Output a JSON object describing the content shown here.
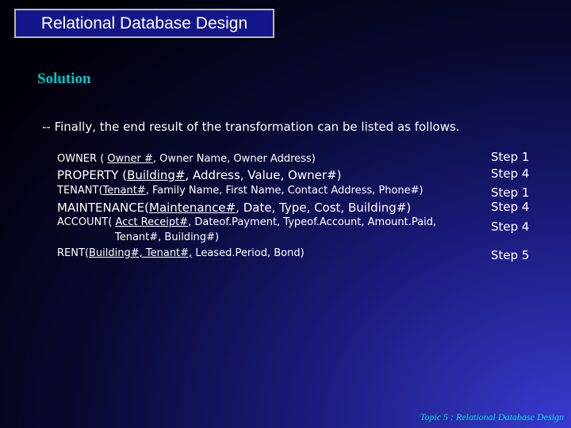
{
  "slide_title": "Relational Database Design",
  "heading": "Solution",
  "intro": "-- Finally, the end result of the transformation can be listed as follows.",
  "relations": {
    "owner": {
      "name": "OWNER ( ",
      "key": "Owner #",
      "rest": ", Owner Name, Owner Address)"
    },
    "property": {
      "name": "PROPERTY (",
      "key": "Building#",
      "rest": ", Address, Value, Owner#)"
    },
    "tenant": {
      "name": "TENANT(",
      "key": "Tenant#",
      "rest": ", Family Name, First Name, Contact Address, Phone#)"
    },
    "maintenance": {
      "name": "MAINTENANCE(",
      "key": "Maintenance#",
      "rest": ", Date, Type, Cost, Building#)"
    },
    "account": {
      "name": "ACCOUNT( ",
      "key": "Acct Receipt#",
      "rest": ", Dateof.Payment, Typeof.Account, Amount.Paid,",
      "line2": "Tenant#, Building#)"
    },
    "rent": {
      "name": "RENT(",
      "key": "Building#, Tenant#,",
      "rest": " Leased.Period, Bond)"
    }
  },
  "steps": [
    "Step 1",
    "Step 4",
    "Step 1",
    "Step 4",
    "Step 4",
    "Step 5"
  ],
  "footer": "Topic 5 : Relational Database Design"
}
